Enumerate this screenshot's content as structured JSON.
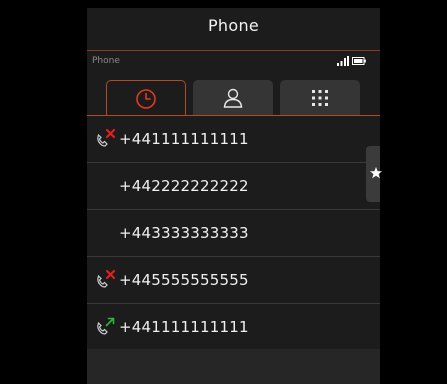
{
  "app": {
    "title": "Phone",
    "status_title": "Phone"
  },
  "status_icons": [
    "signal-icon",
    "battery-icon"
  ],
  "tabs": [
    {
      "name": "recents",
      "icon": "clock-icon",
      "active": true
    },
    {
      "name": "contacts",
      "icon": "person-icon",
      "active": false
    },
    {
      "name": "keypad",
      "icon": "dialpad-icon",
      "active": false
    }
  ],
  "calls": [
    {
      "number": "+441111111111",
      "type": "missed",
      "icon": "missed-call-icon"
    },
    {
      "number": "+442222222222",
      "type": "none",
      "icon": ""
    },
    {
      "number": "+443333333333",
      "type": "none",
      "icon": ""
    },
    {
      "number": "+445555555555",
      "type": "missed",
      "icon": "missed-call-icon"
    },
    {
      "number": "+441111111111",
      "type": "outgoing",
      "icon": "outgoing-call-icon"
    }
  ],
  "side_action": {
    "icon": "star-icon"
  },
  "colors": {
    "accent": "#b34b22",
    "missed": "#e0201f",
    "outgoing": "#2fb53a",
    "panel": "#1c1c1c",
    "text": "#f0f0f0"
  }
}
